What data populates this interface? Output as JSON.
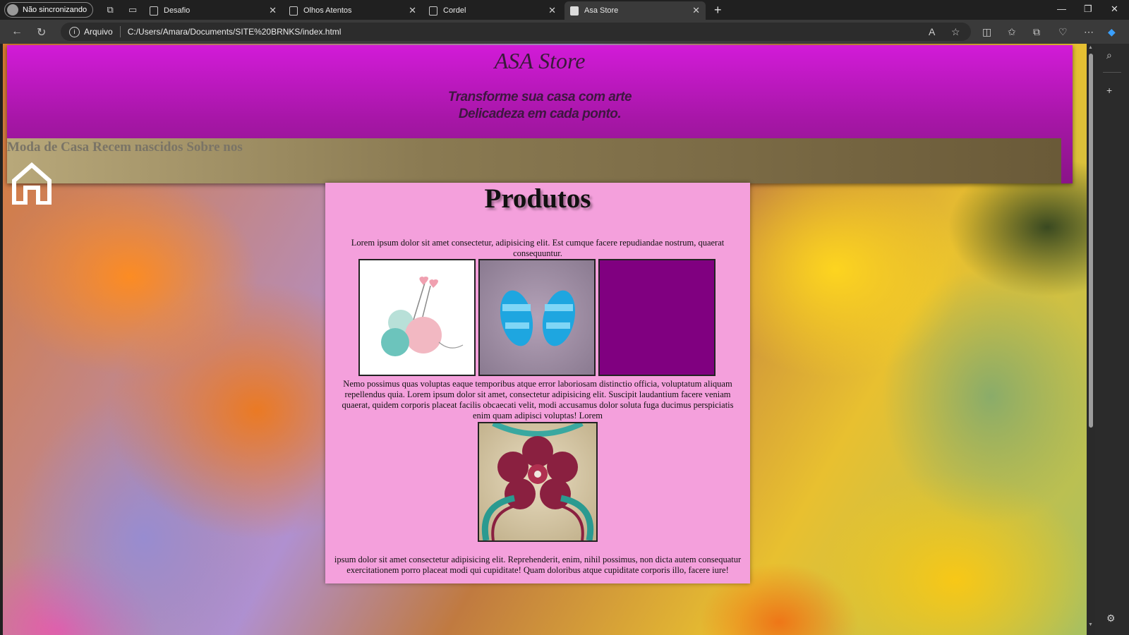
{
  "browser": {
    "profile_label": "Não sincronizando",
    "tabs": [
      {
        "title": "Desafio"
      },
      {
        "title": "Olhos Atentos"
      },
      {
        "title": "Cordel"
      },
      {
        "title": "Asa Store"
      }
    ],
    "active_tab_index": 3,
    "address": {
      "origin_label": "Arquivo",
      "url": "C:/Users/Amara/Documents/SITE%20BRNKS/index.html"
    }
  },
  "site": {
    "title": "ASA Store",
    "tagline_line1": "Transforme sua casa com arte",
    "tagline_line2": "Delicadeza em cada ponto.",
    "menu": [
      "Moda de Casa",
      "Recem nascidos",
      "Sobre nos"
    ]
  },
  "content": {
    "heading": "Produtos",
    "paragraph1": "Lorem ipsum dolor sit amet consectetur, adipisicing elit. Est cumque facere repudiandae nostrum, quaerat consequuntur.",
    "paragraph2": "Nemo possimus quas voluptas eaque temporibus atque error laboriosam distinctio officia, voluptatum aliquam repellendus quia. Lorem ipsum dolor sit amet, consectetur adipisicing elit. Suscipit laudantium facere veniam quaerat, quidem corporis placeat facilis obcaecati velit, modi accusamus dolor soluta fuga ducimus perspiciatis enim quam adipisci voluptas! Lorem",
    "paragraph3": "ipsum dolor sit amet consectetur adipisicing elit. Reprehenderit, enim, nihil possimus, non dicta autem consequatur exercitationem porro placeat modi qui cupiditate! Quam doloribus atque cupiditate corporis illo, facere iure!"
  },
  "colors": {
    "header_top": "#d21bd8",
    "header_bottom": "#8a1488",
    "content_bg": "#f4a0dc",
    "purple_tile": "#800080"
  }
}
